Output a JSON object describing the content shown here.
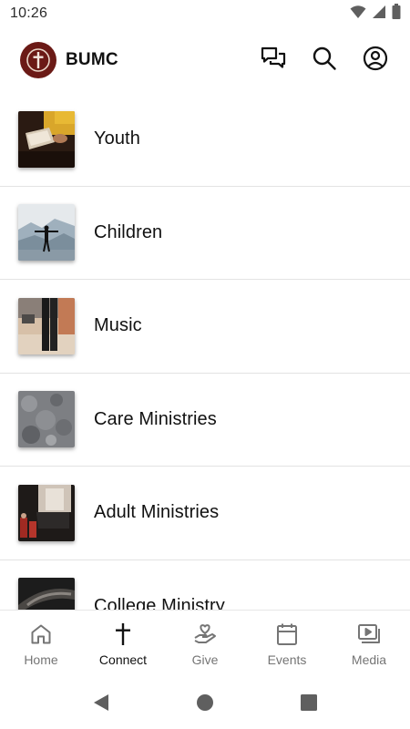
{
  "status_bar": {
    "time": "10:26"
  },
  "header": {
    "title": "BUMC"
  },
  "ministries": [
    {
      "label": "Youth",
      "image": "youth-bible-photo"
    },
    {
      "label": "Children",
      "image": "children-mountain-photo"
    },
    {
      "label": "Music",
      "image": "music-legs-photo"
    },
    {
      "label": "Care Ministries",
      "image": "care-stone-texture-photo"
    },
    {
      "label": "Adult Ministries",
      "image": "adult-people-photo"
    },
    {
      "label": "College Ministry",
      "image": "college-dark-photo"
    }
  ],
  "bottom_nav": [
    {
      "label": "Home",
      "icon": "home-icon",
      "active": false
    },
    {
      "label": "Connect",
      "icon": "cross-icon",
      "active": true
    },
    {
      "label": "Give",
      "icon": "heart-hand-icon",
      "active": false
    },
    {
      "label": "Events",
      "icon": "calendar-icon",
      "active": false
    },
    {
      "label": "Media",
      "icon": "media-play-icon",
      "active": false
    }
  ],
  "colors": {
    "brand": "#6b1a16",
    "active_nav": "#111111",
    "inactive_nav": "#757575",
    "divider": "#e3e3e3"
  }
}
